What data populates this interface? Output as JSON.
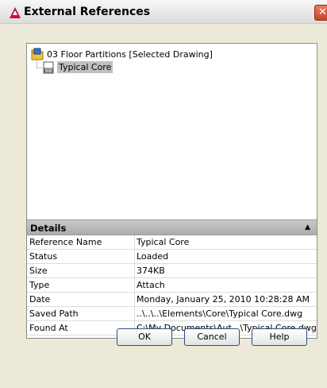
{
  "window": {
    "title": "External References"
  },
  "tree": {
    "root_label": "03 Floor Partitions [Selected Drawing]",
    "child_label": "Typical Core",
    "child_icon_text": "DWG"
  },
  "details": {
    "header": "Details",
    "collapse_arrow": "▲",
    "rows": [
      {
        "key": "Reference Name",
        "value": "Typical Core"
      },
      {
        "key": "Status",
        "value": "Loaded"
      },
      {
        "key": "Size",
        "value": "374KB"
      },
      {
        "key": "Type",
        "value": "Attach"
      },
      {
        "key": "Date",
        "value": "Monday, January 25, 2010 10:28:28 AM"
      },
      {
        "key": "Saved Path",
        "value": "..\\..\\..\\Elements\\Core\\Typical Core.dwg"
      },
      {
        "key": "Found At",
        "value": "C:\\My Documents\\Aut...\\Typical Core.dwg"
      }
    ]
  },
  "buttons": {
    "ok": "OK",
    "cancel": "Cancel",
    "help": "Help"
  },
  "close_glyph": "✕",
  "colors": {
    "close_red": "#c8432a",
    "selection_gray": "#c0c0c0"
  }
}
